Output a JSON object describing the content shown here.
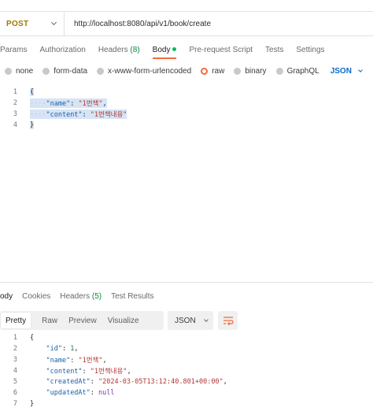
{
  "request": {
    "method": "POST",
    "url": "http://localhost:8080/api/v1/book/create"
  },
  "request_tabs": {
    "params": "Params",
    "authorization": "Authorization",
    "headers": "Headers",
    "headers_count": "(8)",
    "body": "Body",
    "prerequest": "Pre-request Script",
    "tests": "Tests",
    "settings": "Settings"
  },
  "body_types": {
    "none": "none",
    "form_data": "form-data",
    "urlencoded": "x-www-form-urlencoded",
    "raw": "raw",
    "binary": "binary",
    "graphql": "GraphQL",
    "selected_format": "JSON"
  },
  "request_body": {
    "line_numbers": [
      "1",
      "2",
      "3",
      "4"
    ],
    "open_brace": "{",
    "close_brace": "}",
    "name_key": "\"name\"",
    "name_value": "\"1번책\"",
    "content_key": "\"content\"",
    "content_value": "\"1번책내용\""
  },
  "response_tabs": {
    "body": "ody",
    "cookies": "Cookies",
    "headers": "Headers",
    "headers_count": "(5)",
    "test_results": "Test Results"
  },
  "response_toolbar": {
    "pretty": "Pretty",
    "raw": "Raw",
    "preview": "Preview",
    "visualize": "Visualize",
    "format": "JSON"
  },
  "response_body": {
    "line_numbers": [
      "1",
      "2",
      "3",
      "4",
      "5",
      "6",
      "7"
    ],
    "open_brace": "{",
    "close_brace": "}",
    "id_key": "\"id\"",
    "id_value": "1",
    "name_key": "\"name\"",
    "name_value": "\"1번책\"",
    "content_key": "\"content\"",
    "content_value": "\"1번책내용\"",
    "created_key": "\"createdAt\"",
    "created_value": "\"2024-03-05T13:12:40.801+00:00\"",
    "updated_key": "\"updatedAt\"",
    "updated_value": "null"
  },
  "icons": {
    "method_dropdown": "chevron-down-icon",
    "format_dropdown": "chevron-down-icon",
    "wrap": "wrap-lines-icon"
  },
  "colors": {
    "accent": "#f26b3a",
    "method": "#a07a00",
    "json_link": "#0b6bcb",
    "count_green": "#0c8a3e"
  }
}
